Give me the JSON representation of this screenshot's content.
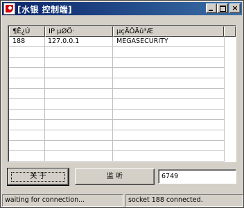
{
  "window": {
    "title": "[水银 控制端]"
  },
  "title_buttons": {
    "minimize": "_",
    "maximize": "□",
    "close": "×"
  },
  "list": {
    "columns": [
      "¶Ë¿Ú",
      "IP µØÖ·",
      "µçÄÔÃû³Æ",
      ""
    ],
    "rows": [
      [
        "188",
        "127.0.0.1",
        "MEGASECURITY"
      ]
    ]
  },
  "buttons": {
    "close_label": "关 于",
    "listen_label": "监 听"
  },
  "port": {
    "value": "6749"
  },
  "status": {
    "left": "waiting for connection...",
    "right": "socket 188 connected."
  }
}
